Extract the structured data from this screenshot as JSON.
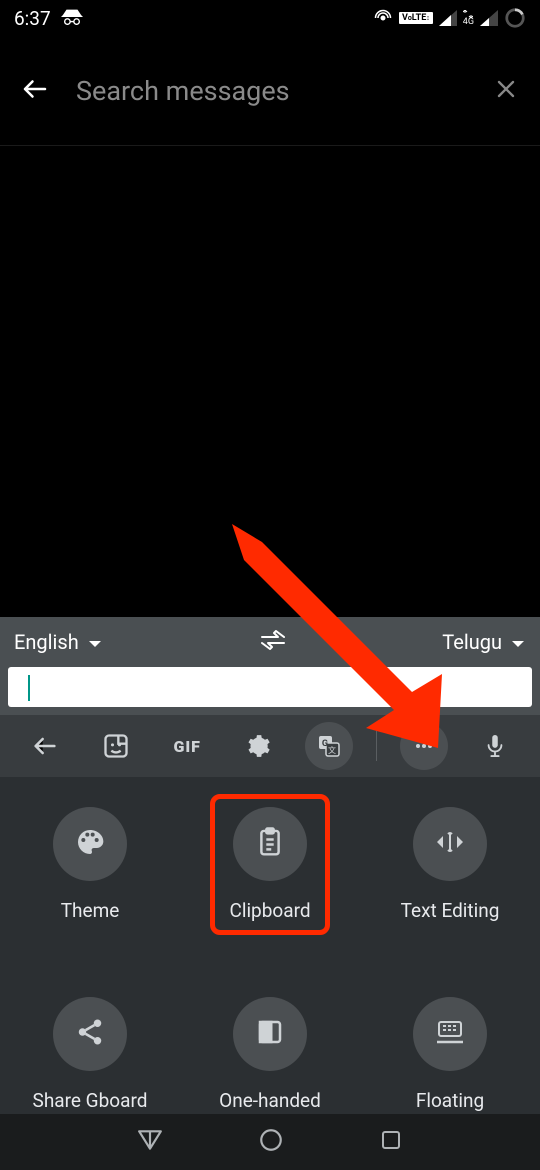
{
  "status": {
    "time": "6:37",
    "network_label": "4G",
    "volte": "VoLTE"
  },
  "app": {
    "search_placeholder": "Search messages"
  },
  "keyboard": {
    "lang_from": "English",
    "lang_to": "Telugu",
    "toolbar": {
      "gif": "GIF"
    },
    "options": {
      "theme": "Theme",
      "clipboard": "Clipboard",
      "text_editing": "Text Editing",
      "share": "Share Gboard",
      "one_handed": "One-handed",
      "floating": "Floating"
    }
  }
}
